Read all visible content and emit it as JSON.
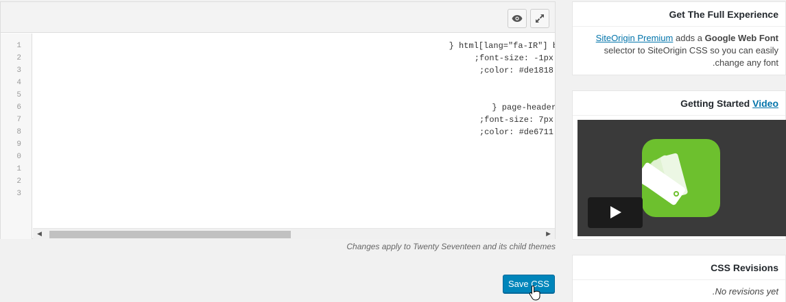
{
  "toolbar": {
    "preview_icon": "eye-icon",
    "expand_icon": "expand-icon"
  },
  "editor": {
    "line_numbers": [
      "1",
      "2",
      "3",
      "4",
      "5",
      "6",
      "7",
      "8",
      "9",
      "0",
      "1",
      "2",
      "3"
    ],
    "lines": [
      {
        "text": "} html[lang=\"fa-IR\"] b"
      },
      {
        "text": ";font-size: -1px"
      },
      {
        "text": ";color: #de1818"
      },
      {
        "text": ""
      },
      {
        "text": ""
      },
      {
        "text": "} page-header"
      },
      {
        "text": ";font-size: 7px"
      },
      {
        "text": ";color: #de6711"
      }
    ]
  },
  "note": "Changes apply to Twenty Seventeen and its child themes",
  "save_button": "Save CSS",
  "sidebar": {
    "premium": {
      "title": "Get The Full Experience",
      "link": "SiteOrigin Premium",
      "text1": " adds a ",
      "bold": "Google Web Font",
      "text2": "selector to SiteOrigin CSS so you can easily",
      "text3": ".change any font"
    },
    "video": {
      "title_prefix": "Getting Started ",
      "title_link": "Video"
    },
    "revisions": {
      "title": "CSS Revisions",
      "empty": ".No revisions yet"
    }
  }
}
